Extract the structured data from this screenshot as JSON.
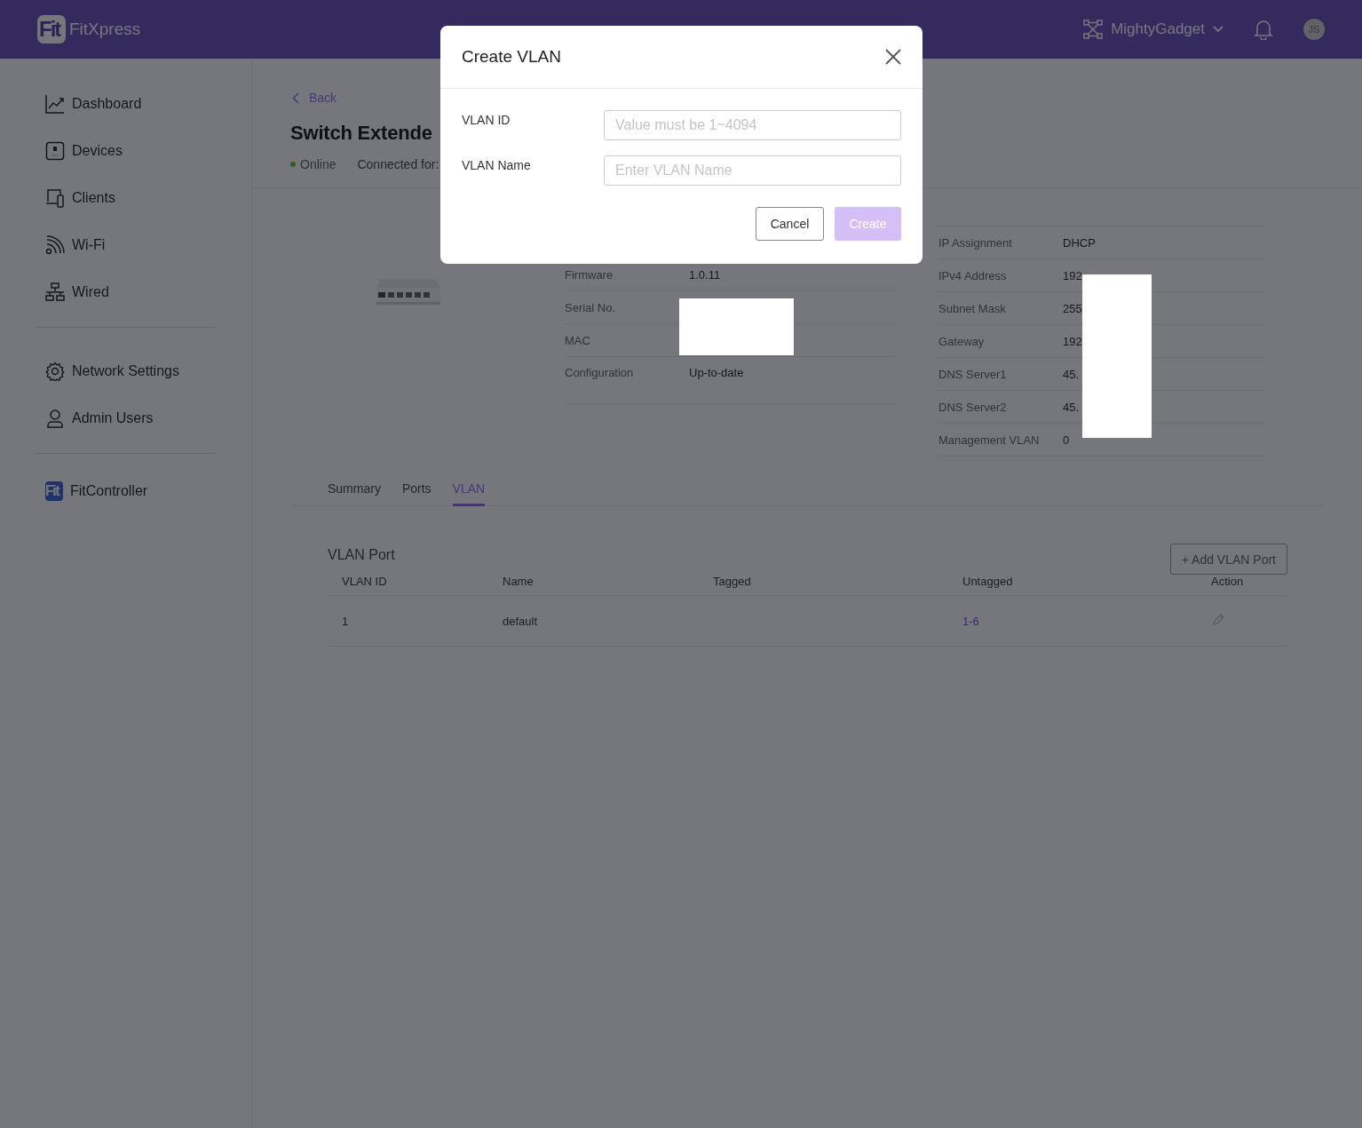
{
  "header": {
    "logo_mark": "Fit",
    "app_name": "FitXpress",
    "organization": "MightyGadget",
    "avatar_initials": "JS"
  },
  "sidebar": {
    "groups": [
      {
        "items": [
          {
            "kind": "dashboard",
            "label": "Dashboard",
            "selected": false
          },
          {
            "kind": "devices",
            "label": "Devices",
            "selected": false
          },
          {
            "kind": "clients",
            "label": "Clients",
            "selected": false
          },
          {
            "kind": "wifi",
            "label": "Wi-Fi",
            "selected": false
          },
          {
            "kind": "wired",
            "label": "Wired",
            "selected": false
          }
        ]
      },
      {
        "items": [
          {
            "kind": "settings",
            "label": "Network Settings",
            "selected": false
          },
          {
            "kind": "users",
            "label": "Admin Users",
            "selected": false
          }
        ]
      }
    ],
    "controller_link": {
      "logo_mark": "Fit",
      "label": "FitController"
    }
  },
  "device": {
    "back": "Back",
    "title": "Switch Extende",
    "status": "Online",
    "online": true,
    "connected_label": "Connected for:",
    "info_left": [
      {
        "label": "Firmware",
        "value": "1.0.11"
      },
      {
        "label": "Serial No."
      },
      {
        "label": "MAC"
      },
      {
        "label": "Configuration",
        "value": "Up-to-date"
      }
    ],
    "info_right": [
      {
        "label": "IP Assignment",
        "value": "DHCP"
      },
      {
        "label": "IPv4 Address",
        "value": "192"
      },
      {
        "label": "Subnet Mask",
        "value": "255"
      },
      {
        "label": "Gateway",
        "value": "192"
      },
      {
        "label": "DNS Server1",
        "value": "45."
      },
      {
        "label": "DNS Server2",
        "value": "45."
      },
      {
        "label": "Management VLAN",
        "value": "0"
      }
    ]
  },
  "tabs": [
    {
      "label": "Summary",
      "selected": false
    },
    {
      "label": "Ports",
      "selected": false
    },
    {
      "label": "VLAN",
      "selected": true
    }
  ],
  "vlan_port": {
    "title": "VLAN Port",
    "add_button": "+ Add VLAN Port",
    "columns": [
      "VLAN ID",
      "Name",
      "Tagged",
      "Untagged",
      "Action"
    ],
    "rows": [
      {
        "vlan_id": "1",
        "name": "default",
        "untagged": "1-6"
      }
    ]
  },
  "dialog": {
    "title": "Create VLAN",
    "fields": [
      {
        "label": "VLAN ID",
        "placeholder": "Value must be 1~4094"
      },
      {
        "label": "VLAN Name",
        "placeholder": "Enter VLAN Name"
      }
    ],
    "cancel": "Cancel",
    "create": {
      "label": "Create",
      "disabled": true
    }
  }
}
